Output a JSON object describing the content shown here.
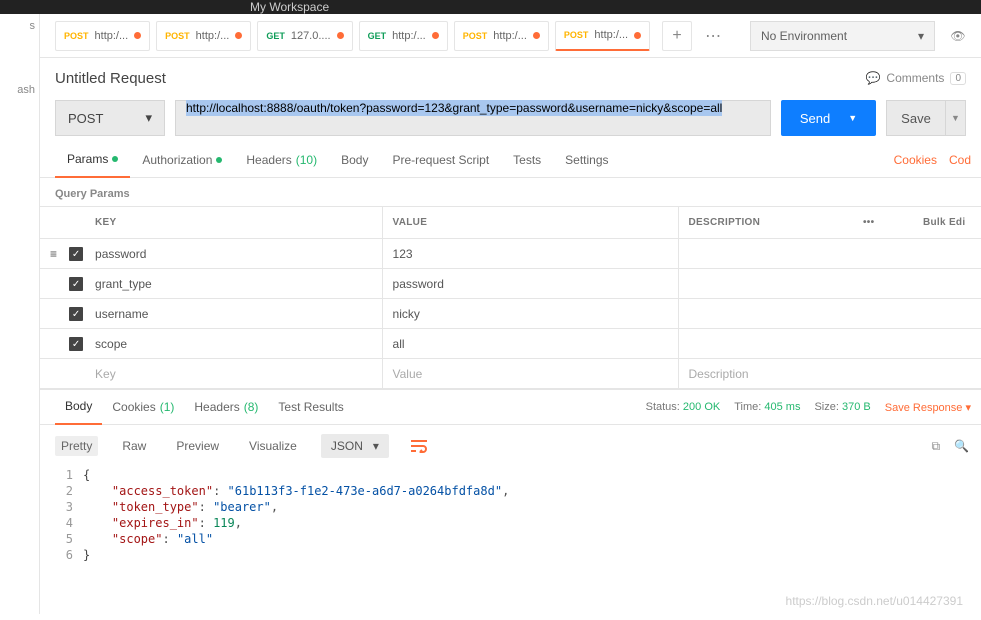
{
  "top": {
    "workspace": "My Workspace"
  },
  "leftRail": {
    "item1": "s",
    "item2": "ash"
  },
  "tabs": [
    {
      "method": "POST",
      "methodClass": "post",
      "label": "http:/...",
      "dot": "orange"
    },
    {
      "method": "POST",
      "methodClass": "post",
      "label": "http:/...",
      "dot": "orange"
    },
    {
      "method": "GET",
      "methodClass": "get",
      "label": "127.0....",
      "dot": "orange"
    },
    {
      "method": "GET",
      "methodClass": "get",
      "label": "http:/...",
      "dot": "orange"
    },
    {
      "method": "POST",
      "methodClass": "post",
      "label": "http:/...",
      "dot": "orange"
    },
    {
      "method": "POST",
      "methodClass": "post",
      "label": "http:/...",
      "dot": "orange",
      "active": true
    }
  ],
  "env": {
    "label": "No Environment"
  },
  "request": {
    "title": "Untitled Request",
    "commentsLabel": "Comments",
    "commentsCount": "0",
    "method": "POST",
    "url": "http://localhost:8888/oauth/token?password=123&grant_type=password&username=nicky&scope=all",
    "sendLabel": "Send",
    "saveLabel": "Save"
  },
  "reqTabs": {
    "params": "Params",
    "auth": "Authorization",
    "headers": "Headers",
    "headersCount": "(10)",
    "body": "Body",
    "prereq": "Pre-request Script",
    "tests": "Tests",
    "settings": "Settings",
    "cookies": "Cookies",
    "code": "Cod"
  },
  "queryParams": {
    "title": "Query Params",
    "headers": {
      "key": "KEY",
      "value": "VALUE",
      "desc": "DESCRIPTION",
      "bulk": "Bulk Edi"
    },
    "rows": [
      {
        "key": "password",
        "value": "123"
      },
      {
        "key": "grant_type",
        "value": "password"
      },
      {
        "key": "username",
        "value": "nicky"
      },
      {
        "key": "scope",
        "value": "all"
      }
    ],
    "placeholders": {
      "key": "Key",
      "value": "Value",
      "desc": "Description"
    }
  },
  "respTabs": {
    "body": "Body",
    "cookies": "Cookies",
    "cookiesCount": "(1)",
    "headers": "Headers",
    "headersCount": "(8)",
    "tests": "Test Results"
  },
  "respMeta": {
    "statusLabel": "Status:",
    "status": "200 OK",
    "timeLabel": "Time:",
    "time": "405 ms",
    "sizeLabel": "Size:",
    "size": "370 B",
    "save": "Save Response"
  },
  "view": {
    "pretty": "Pretty",
    "raw": "Raw",
    "preview": "Preview",
    "visualize": "Visualize",
    "format": "JSON"
  },
  "json": {
    "l1": "{",
    "l2k": "\"access_token\"",
    "l2v": "\"61b113f3-f1e2-473e-a6d7-a0264bfdfa8d\"",
    "l3k": "\"token_type\"",
    "l3v": "\"bearer\"",
    "l4k": "\"expires_in\"",
    "l4v": "119",
    "l5k": "\"scope\"",
    "l5v": "\"all\"",
    "l6": "}"
  },
  "watermark": "https://blog.csdn.net/u014427391"
}
